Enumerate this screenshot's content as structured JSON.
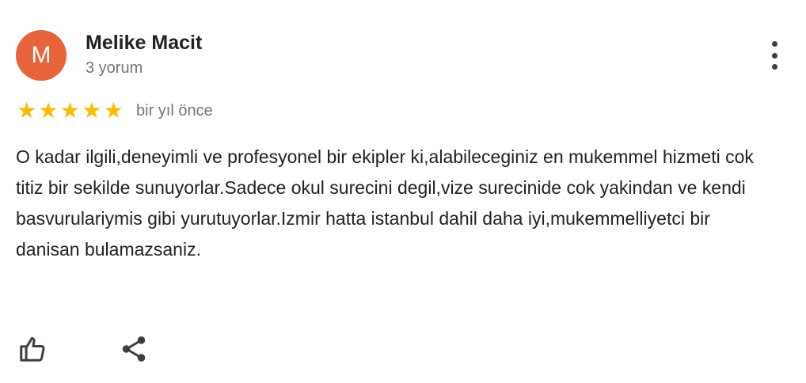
{
  "reviewer": {
    "initial": "M",
    "name": "Melike Macit",
    "review_count": "3 yorum",
    "avatar_color": "#e8643a"
  },
  "rating": {
    "value": 5,
    "max": 5,
    "star_color": "#fbbc04"
  },
  "time_ago": "bir yıl önce",
  "review_text": "O kadar ilgili,deneyimli ve profesyonel bir ekipler ki,alabileceginiz en mukemmel hizmeti cok titiz bir sekilde sunuyorlar.Sadece okul surecini degil,vize surecinide cok yakindan ve kendi basvurulariymis gibi yurutuyorlar.Izmir hatta istanbul dahil daha iyi,mukemmelliyetci bir danisan bulamazsaniz.",
  "icons": {
    "more": "more-vert-icon",
    "like": "thumb-up-icon",
    "share": "share-icon"
  }
}
